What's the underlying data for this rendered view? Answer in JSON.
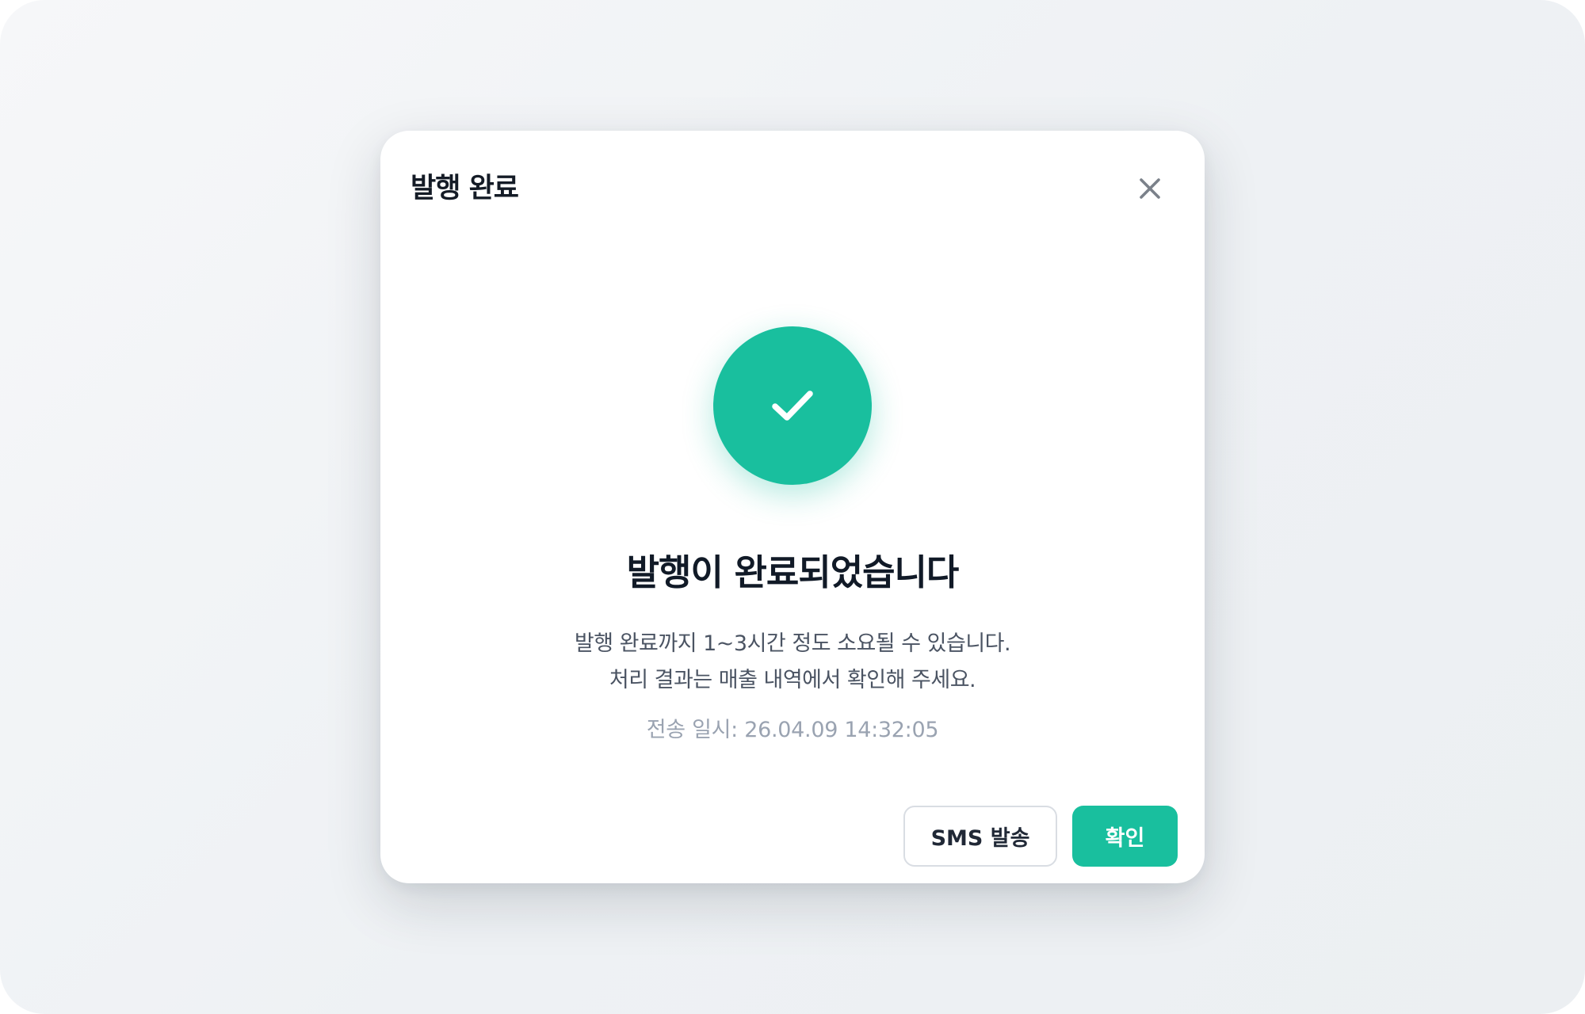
{
  "colors": {
    "accent": "#19bf9e",
    "background": "#eef1f4",
    "title_text": "#141b26",
    "muted_text": "#9aa3b1"
  },
  "dialog": {
    "title": "발행 완료",
    "close_icon": "close-icon",
    "status_icon": "check-icon",
    "headline": "발행이 완료되었습니다",
    "description_line1": "발행 완료까지 1~3시간 정도 소요될 수 있습니다.",
    "description_line2": "처리 결과는 매출 내역에서 확인해 주세요.",
    "timestamp": "전송 일시: 26.04.09 14:32:05",
    "buttons": {
      "sms_label": "SMS 발송",
      "confirm_label": "확인"
    }
  }
}
